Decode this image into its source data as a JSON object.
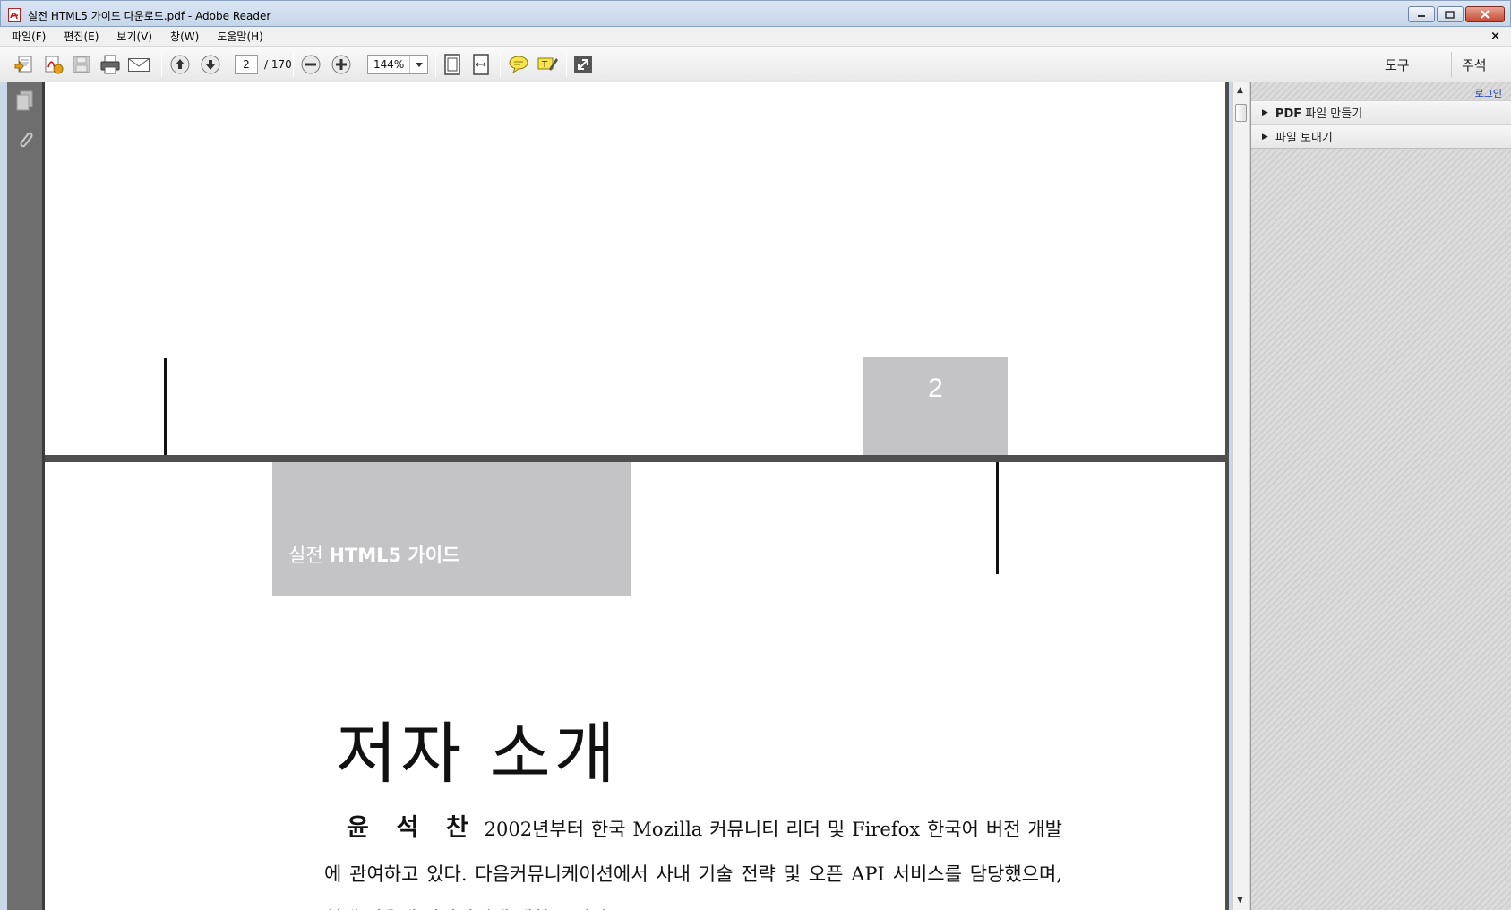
{
  "window": {
    "title": "실전 HTML5 가이드 다운로드.pdf - Adobe Reader",
    "app_icon": "pdf-file-icon"
  },
  "menu": {
    "items": [
      "파일(F)",
      "편집(E)",
      "보기(V)",
      "창(W)",
      "도움말(H)"
    ],
    "close_doc": "×"
  },
  "toolbar": {
    "current_page": "2",
    "total_pages": "/ 170",
    "zoom": "144%",
    "tabs": {
      "tools": "도구",
      "comment": "주석"
    }
  },
  "document": {
    "page_number": "2",
    "book_label_prefix": "실전 ",
    "book_label_main": "HTML5 가이드",
    "heading": "저자 소개",
    "author_name": "윤 석 찬",
    "author_bio": "2002년부터 한국 Mozilla 커뮤니티 리더 및 Firefox 한국어 버전 개발에 관여하고 있다. 다음커뮤니케이션에서 사내 기술 전략 및 오픈 API 서비스를 담당했으며, 현재 서울대 박사과정에 재학 중이다."
  },
  "taskpane": {
    "login": "로그인",
    "items": [
      {
        "bold": "PDF",
        "label": " 파일 만들기"
      },
      {
        "bold": "",
        "label": "파일 보내기"
      }
    ]
  },
  "colors": {
    "page_separator": "#4f4f4f",
    "label_box": "#c4c3c5",
    "nav_pane": "#6e6e6e"
  }
}
